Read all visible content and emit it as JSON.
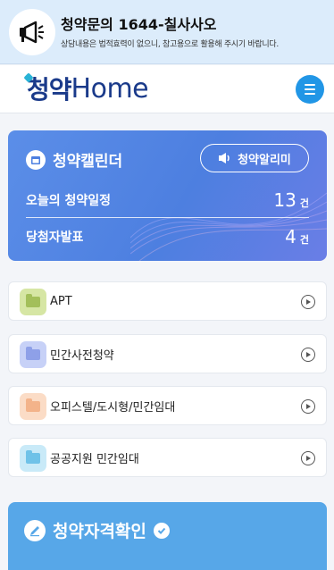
{
  "banner": {
    "title": "청약문의 1644-칠사사오",
    "subtitle": "상담내용은 법적효력이 없으니, 참고용으로 활용해 주시기 바랍니다.",
    "icon": "megaphone-icon"
  },
  "header": {
    "logo_korean": "청약",
    "logo_english": "Home",
    "menu_icon": "hamburger-icon"
  },
  "calendar": {
    "title": "청약캘린더",
    "alarm_button": "청약알리미",
    "rows": [
      {
        "label": "오늘의 청약일정",
        "count": "13",
        "unit": "건"
      },
      {
        "label": "당첨자발표",
        "count": "4",
        "unit": "건"
      }
    ]
  },
  "categories": [
    {
      "label": "APT",
      "color": "#c9dc8e",
      "folder_color": "#9dbb4f"
    },
    {
      "label": "민간사전청약",
      "color": "#c3cdf6",
      "folder_color": "#8c9ee8"
    },
    {
      "label": "오피스텔/도시형/민간임대",
      "color": "#fbd9c1",
      "folder_color": "#f4b287"
    },
    {
      "label": "공공지원 민간임대",
      "color": "#c4e8f7",
      "folder_color": "#6cc1e8"
    }
  ],
  "qualification": {
    "title": "청약자격확인"
  },
  "colors": {
    "accent": "#4d7fe0",
    "menu": "#2196e6",
    "qual": "#57a7e8"
  }
}
